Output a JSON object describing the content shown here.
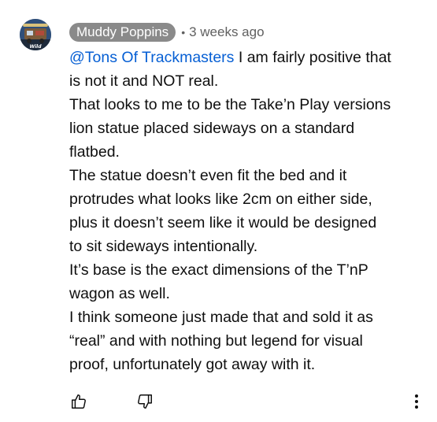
{
  "comment": {
    "author": "Muddy Poppins",
    "separator": "•",
    "timestamp": "3 weeks ago",
    "mention": "@Tons Of Trackmasters",
    "lines": [
      " I am fairly positive that",
      "is not it and NOT real.",
      "That looks to me to be the Take’n Play versions",
      "lion statue placed sideways on a standard",
      "flatbed.",
      "The statue doesn’t even fit the bed and it",
      "protrudes what looks like 2cm on either side,",
      "plus it doesn’t seem like it would be designed",
      "to sit sideways intentionally.",
      "It’s base is the exact dimensions of the T’nP",
      "wagon as well.",
      "I think someone just made that and sold it as",
      "“real” and with nothing but legend for visual",
      "proof, unfortunately got away with it."
    ]
  },
  "avatar": {
    "icon": "channel-avatar-icon",
    "badge_text": "Wild"
  },
  "actions": {
    "like_icon": "thumbs-up-icon",
    "dislike_icon": "thumbs-down-icon",
    "more_icon": "more-vertical-icon"
  },
  "colors": {
    "mention": "#065fd4",
    "author_chip_bg": "#8a8a8a",
    "meta_text": "#606060",
    "body_text": "#0f0f0f"
  }
}
